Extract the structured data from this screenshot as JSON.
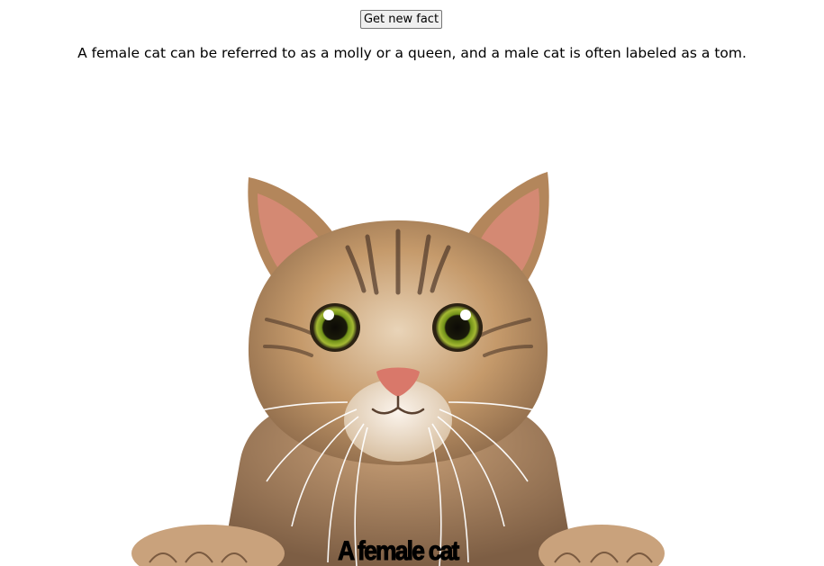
{
  "controls": {
    "new_fact_label": "Get new fact"
  },
  "fact": {
    "text": "A female cat can be referred to as a molly or a queen, and a male cat is often labeled as a tom."
  },
  "image": {
    "subject": "tabby-cat-photo",
    "caption": "A female cat"
  },
  "colors": {
    "fur_light": "#e7cfb1",
    "fur_mid": "#b88a5c",
    "fur_dark": "#5a4130",
    "ear_inner": "#d98a78",
    "eye_iris": "#7a9a1e",
    "nose": "#d9786a"
  }
}
